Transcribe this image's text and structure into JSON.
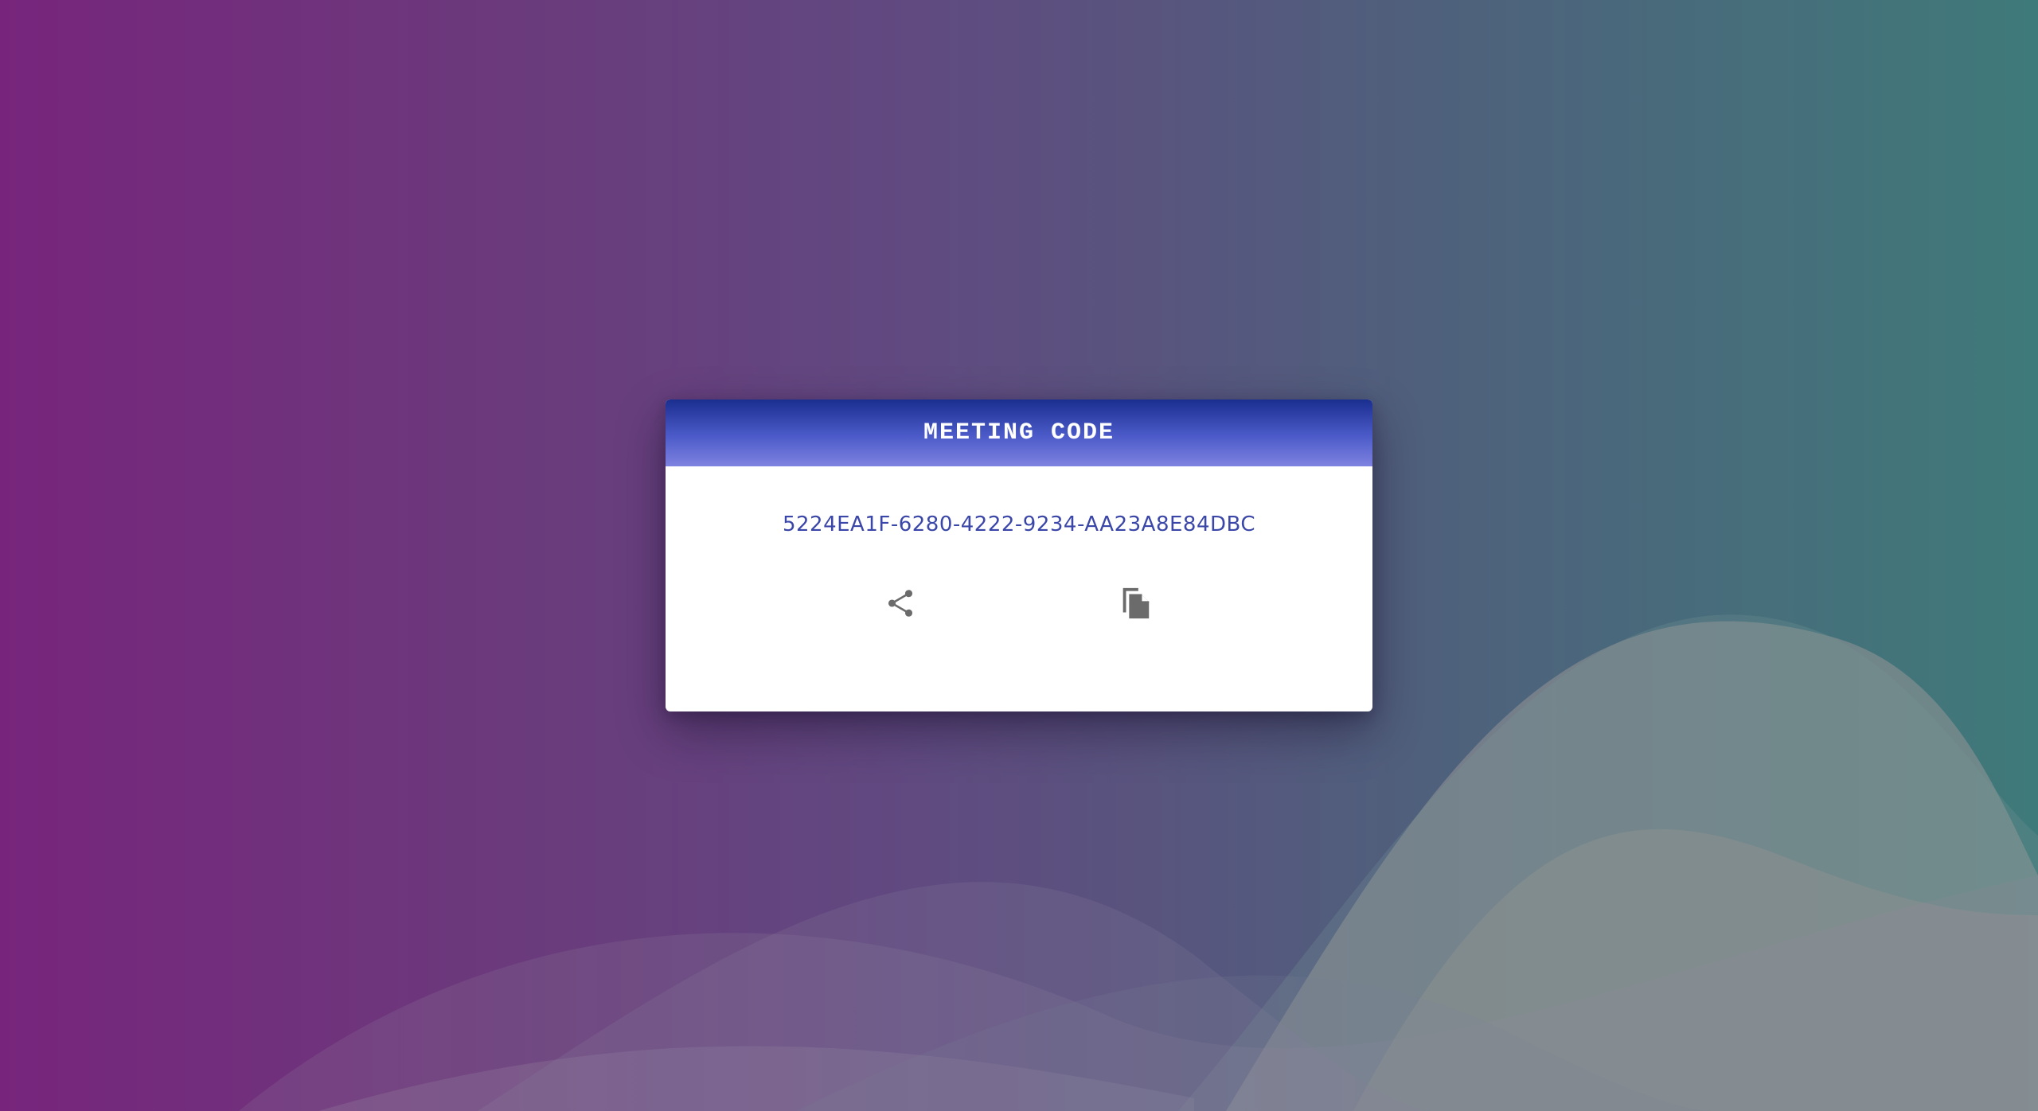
{
  "dialog": {
    "title": "MEETING CODE",
    "code": "5224EA1F-6280-4222-9234-AA23A8E84DBC"
  },
  "actions": {
    "share_icon": "share-icon",
    "copy_icon": "copy-icon"
  },
  "colors": {
    "header_top": "#1a2e8f",
    "header_bottom": "#7e82e0",
    "code_text": "#3b47a8",
    "icon": "#6b6b6b",
    "background_left": "#77257c",
    "background_right": "#3f7a7a"
  }
}
